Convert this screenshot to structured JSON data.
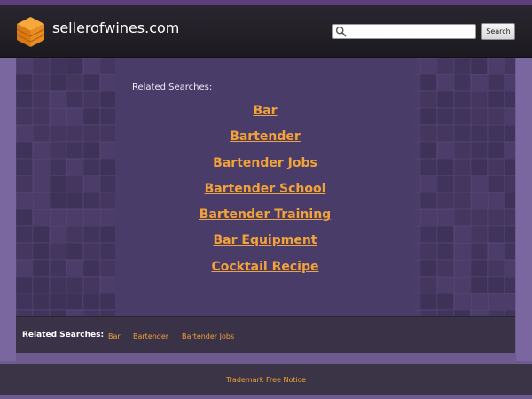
{
  "header": {
    "domain": "sellerofwines.com",
    "search_placeholder": "",
    "search_button_label": "Search"
  },
  "main": {
    "related_label": "Related Searches:",
    "links": [
      "Bar",
      "Bartender",
      "Bartender Jobs",
      "Bartender School",
      "Bartender Training",
      "Bar Equipment",
      "Cocktail Recipe"
    ]
  },
  "bottom_bar": {
    "label": "Related Searches:",
    "links": [
      "Bar",
      "Bartender",
      "Bartender Jobs"
    ]
  },
  "footer": {
    "notice": "Trademark Free Notice"
  },
  "colors": {
    "link": "#f2a23a",
    "panel": "#4b3c69",
    "background": "#6d5a8e",
    "header": "#1f1c24"
  }
}
